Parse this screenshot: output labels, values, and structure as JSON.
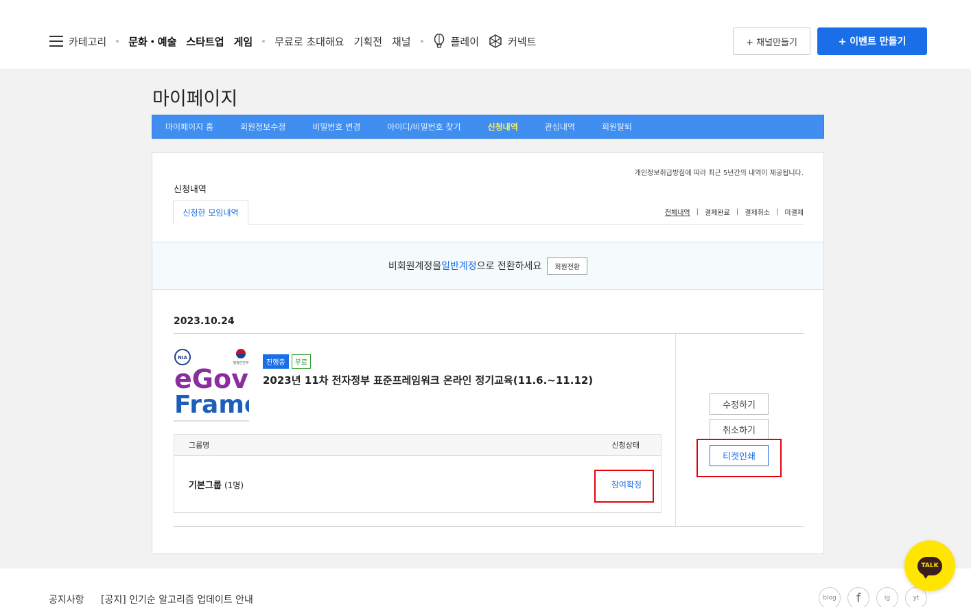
{
  "header": {
    "nav": [
      {
        "label": "카테고리",
        "type": "category"
      },
      {
        "type": "dot"
      },
      {
        "label": "문화・예술",
        "bold": true
      },
      {
        "label": "스타트업",
        "bold": true
      },
      {
        "label": "게임",
        "bold": true
      },
      {
        "type": "dot"
      },
      {
        "label": "무료로 초대해요"
      },
      {
        "label": "기획전"
      },
      {
        "label": "채널"
      },
      {
        "type": "dot"
      },
      {
        "label": "플레이",
        "icon": "balloon-icon"
      },
      {
        "label": "커넥트",
        "icon": "connect-icon"
      }
    ],
    "channel_button": "+ 채널만들기",
    "event_button": "+ 이벤트 만들기"
  },
  "mypage": {
    "title": "마이페이지",
    "tabs": [
      {
        "label": "마이페이지 홈"
      },
      {
        "label": "회원정보수정"
      },
      {
        "label": "비밀번호 변경"
      },
      {
        "label": "아이디/비밀번호 찾기"
      },
      {
        "label": "신청내역",
        "active": true
      },
      {
        "label": "관심내역"
      },
      {
        "label": "회원탈퇴"
      }
    ],
    "notice": "개인정보취급방침에 따라 최근 5년간의 내역이 제공됩니다.",
    "section_title": "신청내역",
    "subtab": "신청한 모임내역",
    "filters": [
      "전체내역",
      "결제완료",
      "결제취소",
      "미결제"
    ],
    "convert": {
      "before": "비회원계정을 ",
      "link": "일반계정",
      "after": "으로 전환하세요",
      "button": "회원전환"
    }
  },
  "application": {
    "date": "2023.10.24",
    "badges": [
      "진행중",
      "무료"
    ],
    "title": "2023년 11차 전자정부 표준프레임워크 온라인 정기교육(11.6.~11.12)",
    "thumbnail": {
      "line1": "eGov",
      "line2": "Frame",
      "logo": "NIA",
      "ministry": "행정안전부"
    },
    "table": {
      "col_group": "그룹명",
      "col_status": "신청상태",
      "group_name": "기본그룹",
      "group_count": "(1명)",
      "status": "참여확정"
    },
    "buttons": {
      "edit": "수정하기",
      "cancel": "취소하기",
      "print": "티켓인쇄"
    }
  },
  "footer": {
    "notice_label": "공지사항",
    "notice_text": "[공지] 인기순 알고리즘 업데이트 안내",
    "social": [
      "blog",
      "f",
      "ig",
      "yt"
    ]
  },
  "talk_label": "TALK",
  "colors": {
    "accent": "#1a6fe8",
    "tabbar": "#3f8ef0",
    "highlight": "#e5000a",
    "talk": "#ffe500"
  }
}
